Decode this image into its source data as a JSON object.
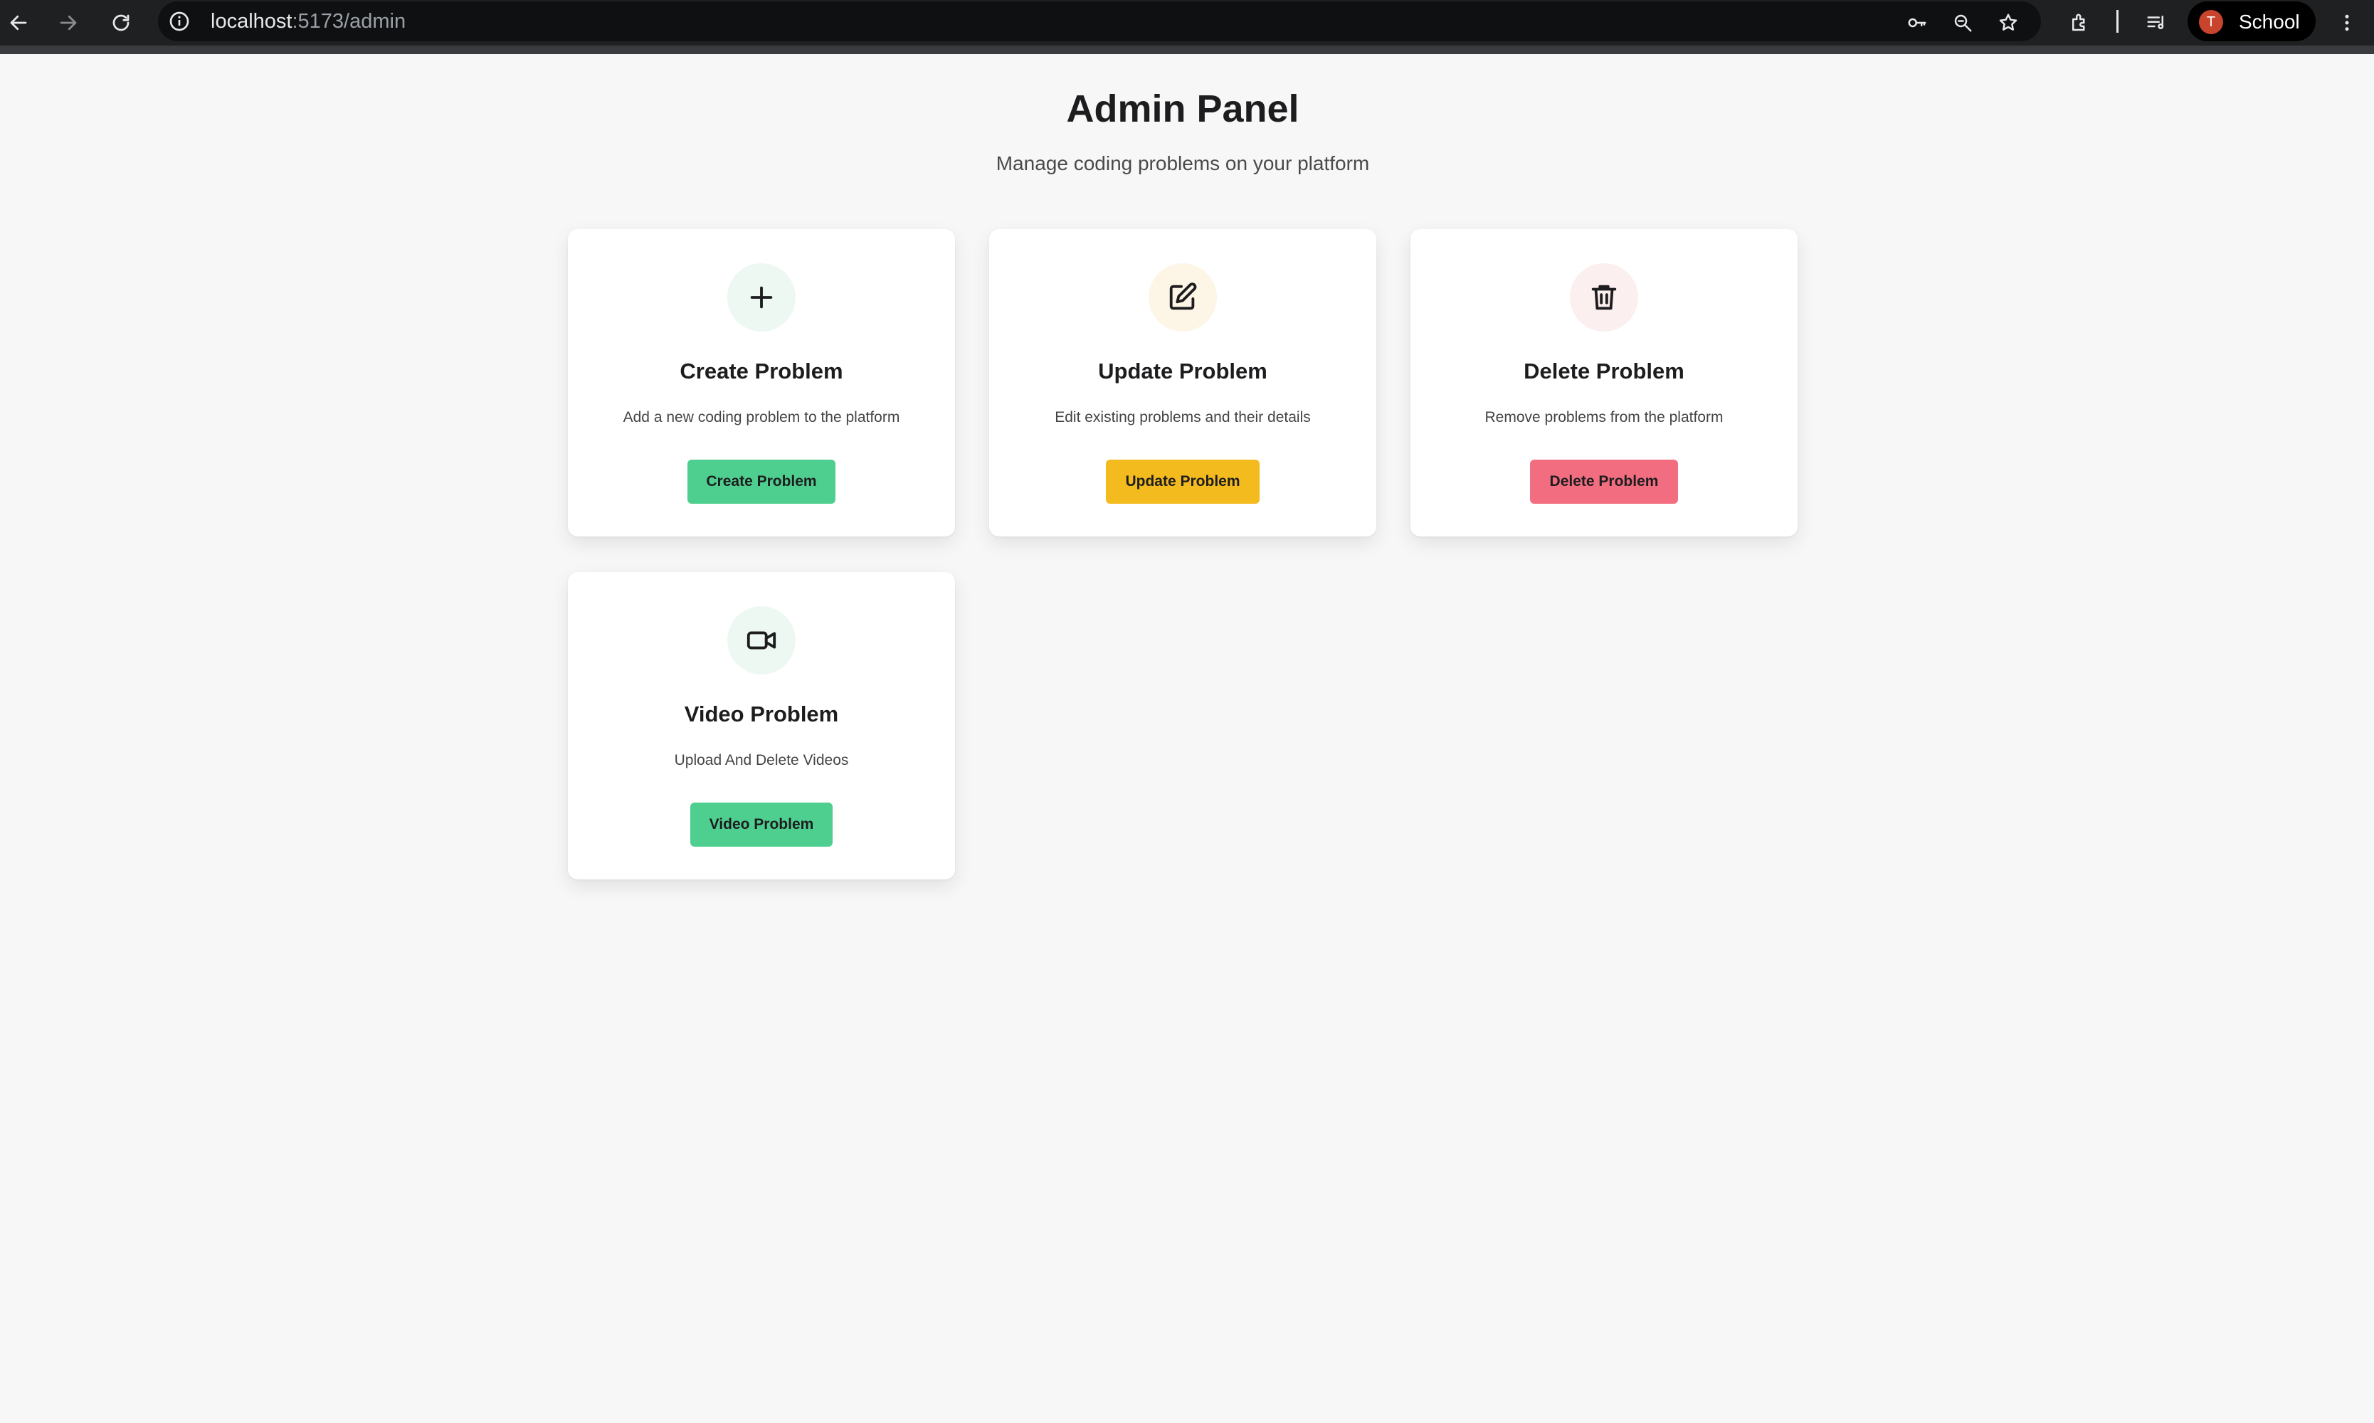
{
  "browser": {
    "url_host": "localhost",
    "url_path": ":5173/admin",
    "profile_initial": "T",
    "profile_label": "School",
    "icons": [
      "back-icon",
      "forward-icon",
      "reload-icon",
      "site-info-icon",
      "password-key-icon",
      "zoom-icon",
      "bookmark-star-icon",
      "extensions-icon",
      "media-controls-icon",
      "menu-icon"
    ]
  },
  "page": {
    "title": "Admin Panel",
    "subtitle": "Manage coding problems on your platform"
  },
  "cards": [
    {
      "icon": "plus-icon",
      "title": "Create Problem",
      "description": "Add a new coding problem to the platform",
      "button": "Create Problem",
      "accent": "#4fcf8f",
      "icon_bg": "#eef8f2"
    },
    {
      "icon": "edit-icon",
      "title": "Update Problem",
      "description": "Edit existing problems and their details",
      "button": "Update Problem",
      "accent": "#f4bb1e",
      "icon_bg": "#fdf6e6"
    },
    {
      "icon": "trash-icon",
      "title": "Delete Problem",
      "description": "Remove problems from the platform",
      "button": "Delete Problem",
      "accent": "#f26d80",
      "icon_bg": "#fcefef"
    },
    {
      "icon": "video-icon",
      "title": "Video Problem",
      "description": "Upload And Delete Videos",
      "button": "Video Problem",
      "accent": "#4fcf8f",
      "icon_bg": "#eef8f2"
    }
  ]
}
